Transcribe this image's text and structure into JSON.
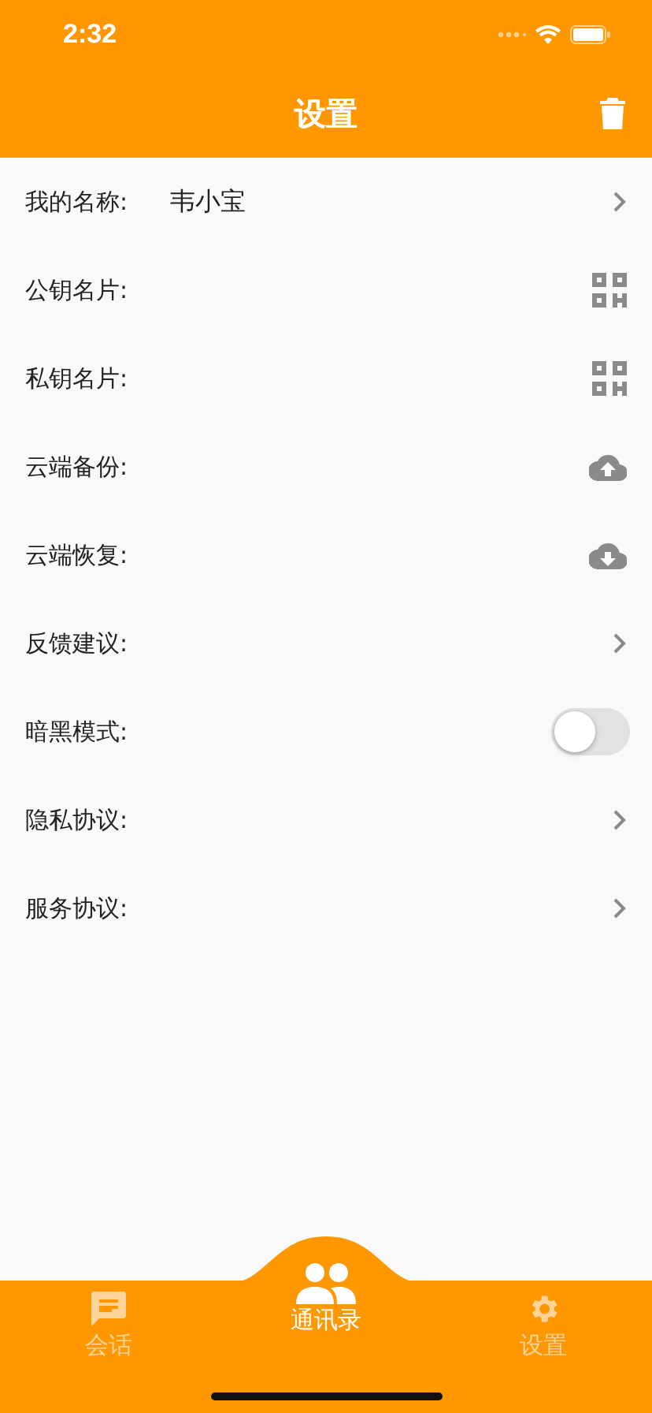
{
  "status_bar": {
    "time": "2:32"
  },
  "header": {
    "title": "设置"
  },
  "rows": [
    {
      "label": "我的名称:",
      "value": "韦小宝",
      "kind": "link"
    },
    {
      "label": "公钥名片:",
      "kind": "qr"
    },
    {
      "label": "私钥名片:",
      "kind": "qr"
    },
    {
      "label": "云端备份:",
      "kind": "upload"
    },
    {
      "label": "云端恢复:",
      "kind": "download"
    },
    {
      "label": "反馈建议:",
      "kind": "link"
    },
    {
      "label": "暗黑模式:",
      "kind": "toggle",
      "on": false
    },
    {
      "label": "隐私协议:",
      "kind": "link"
    },
    {
      "label": "服务协议:",
      "kind": "link"
    }
  ],
  "tabs": [
    {
      "label": "会话",
      "kind": "chat",
      "selected": false
    },
    {
      "label": "通讯录",
      "kind": "people",
      "selected": true
    },
    {
      "label": "设置",
      "kind": "gear",
      "selected": false
    }
  ]
}
